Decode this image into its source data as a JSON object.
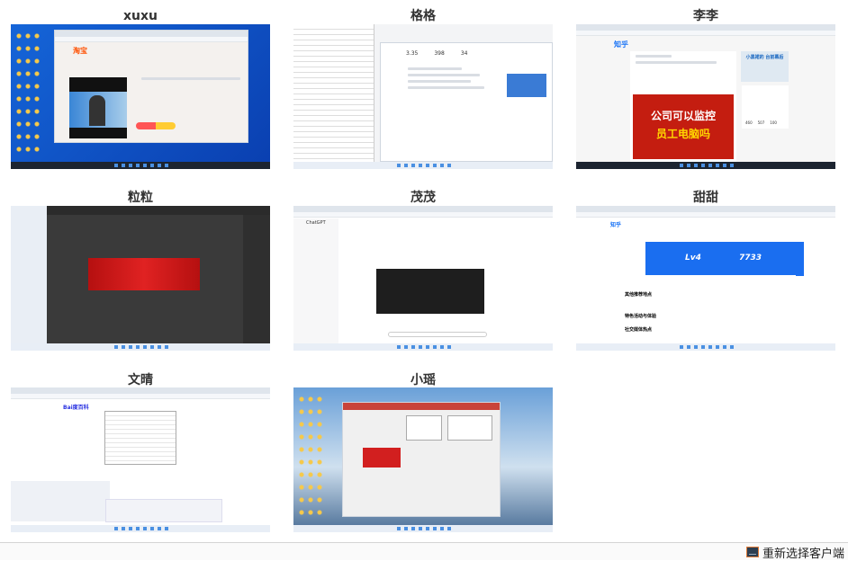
{
  "clients": [
    {
      "name": "xuxu",
      "screen": {
        "brand": "淘宝"
      }
    },
    {
      "name": "格格",
      "screen": {
        "stats": [
          "3.35",
          "398",
          "34"
        ]
      }
    },
    {
      "name": "李李",
      "screen": {
        "brand": "知乎",
        "banner_line1": "公司可以监控",
        "banner_line2": "员工电脑吗",
        "ad": "小黑裙的 台前幕后",
        "counts": [
          "460",
          "507",
          "100"
        ]
      }
    },
    {
      "name": "粒粒",
      "screen": {}
    },
    {
      "name": "茂茂",
      "screen": {
        "app": "ChatGPT"
      }
    },
    {
      "name": "甜甜",
      "screen": {
        "brand": "知乎",
        "level": "Lv4",
        "score": "7733",
        "mindmap": [
          "其他推荐地点",
          "特色活动与体验",
          "社交媒体热点"
        ]
      }
    },
    {
      "name": "文晴",
      "screen": {
        "brand": "Bai度百科"
      }
    },
    {
      "name": "小瑶",
      "screen": {}
    }
  ],
  "footer": {
    "reselect_label": "重新选择客户端",
    "reselect_icon": "monitor-icon"
  }
}
